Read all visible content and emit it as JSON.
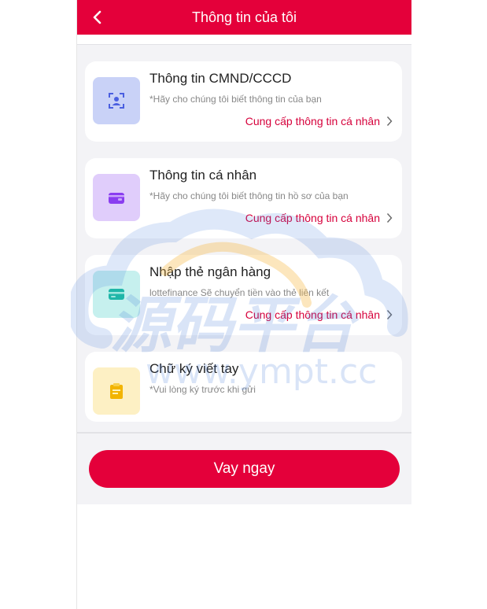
{
  "header": {
    "title": "Thông tin của tôi"
  },
  "cards": [
    {
      "title": "Thông tin CMND/CCCD",
      "desc": "*Hãy cho chúng tôi biết thông tin của bạn",
      "action": "Cung cấp thông tin cá nhân",
      "icon": "id-card-icon",
      "icon_bg": "#c9d2f7",
      "icon_color": "#4a5fe0"
    },
    {
      "title": "Thông tin cá nhân",
      "desc": "*Hãy cho chúng tôi biết thông tin hồ sơ của bạn",
      "action": "Cung cấp thông tin cá nhân",
      "icon": "wallet-icon",
      "icon_bg": "#e0cdfb",
      "icon_color": "#8a3df0"
    },
    {
      "title": "Nhập thẻ ngân hàng",
      "desc": "lottefinance Sẽ chuyển tiền vào thẻ liên kết",
      "action": "Cung cấp thông tin cá nhân",
      "icon": "bank-card-icon",
      "icon_bg": "#c6f0ee",
      "icon_color": "#1fb6a8"
    },
    {
      "title": "Chữ ký viết tay",
      "desc": "*Vui lòng ký trước khi gửi",
      "icon": "clipboard-icon",
      "icon_bg": "#fdf0c4",
      "icon_color": "#f2b400"
    }
  ],
  "submit": {
    "label": "Vay ngay"
  },
  "watermark": {
    "line1": "源码平台",
    "line2": "www.ympt.cc"
  },
  "colors": {
    "accent": "#e4003a",
    "link": "#d6003b",
    "background": "#f3f3f6"
  }
}
